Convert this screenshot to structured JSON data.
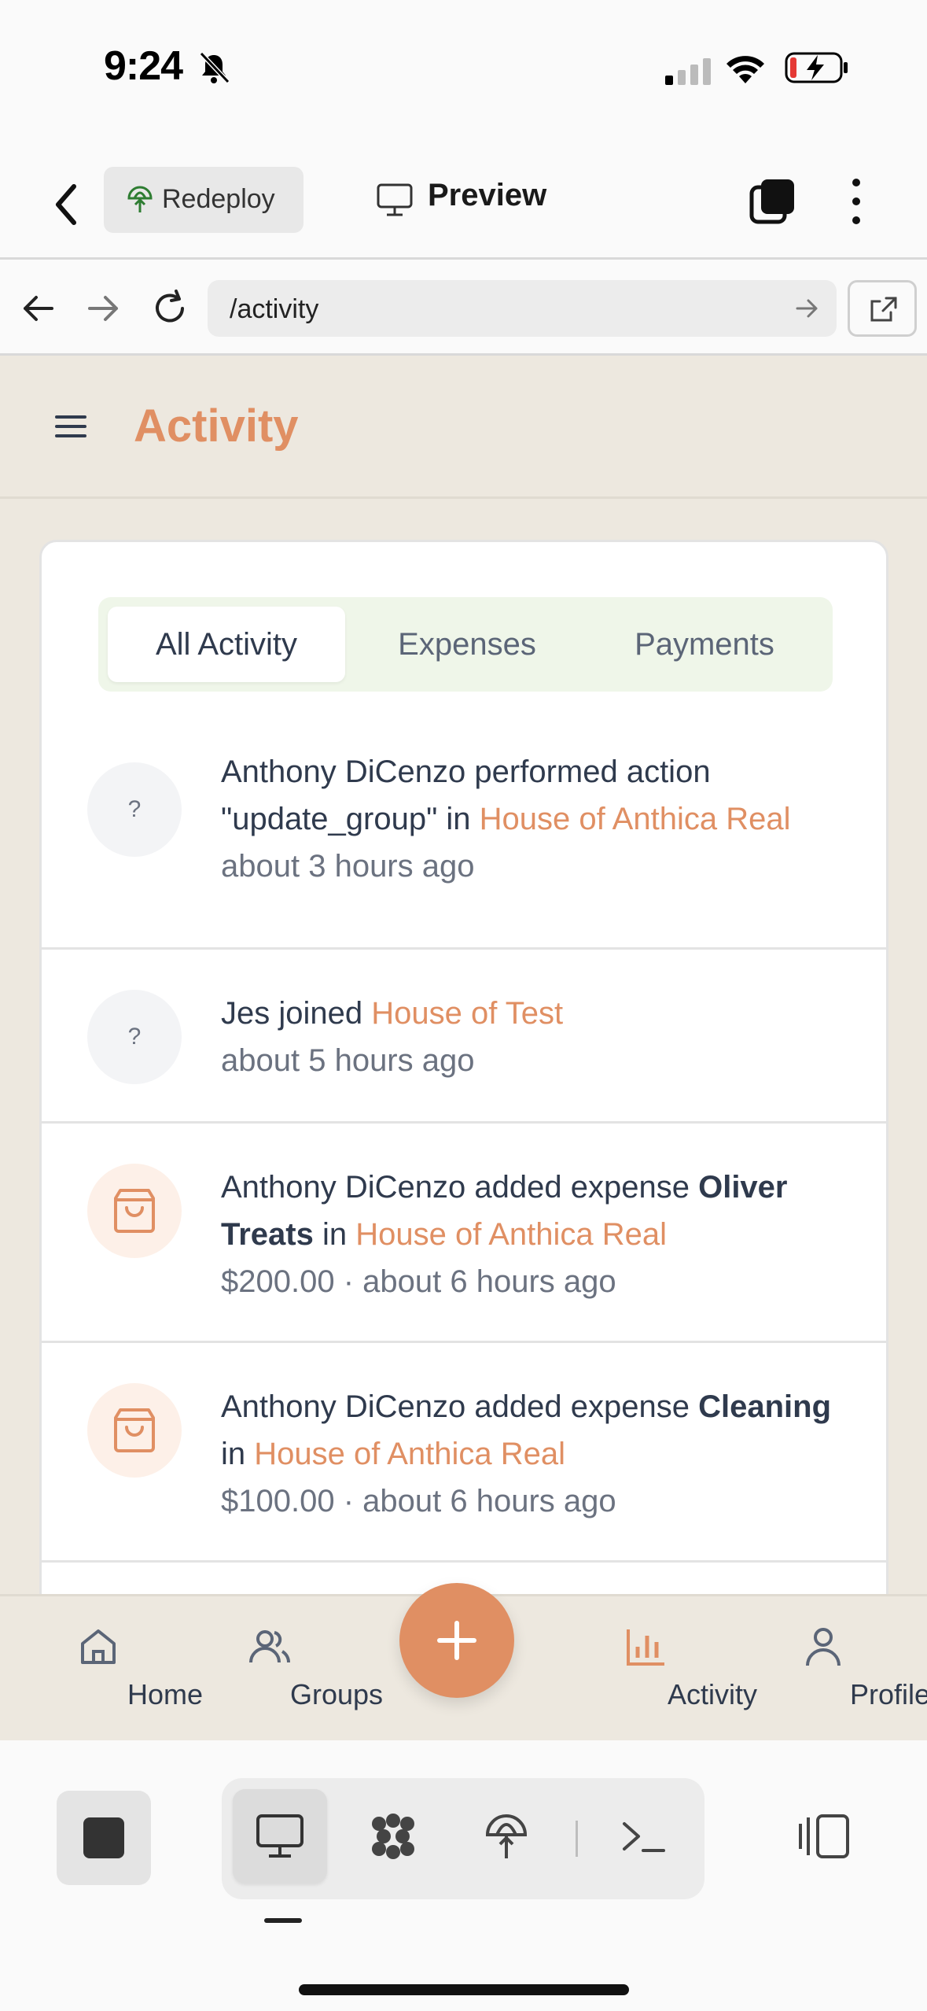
{
  "status_bar": {
    "time": "9:24"
  },
  "editor_bar": {
    "redeploy_label": "Redeploy",
    "preview_label": "Preview"
  },
  "url_bar": {
    "url": "/activity"
  },
  "app": {
    "title": "Activity",
    "tabs": [
      {
        "label": "All Activity",
        "active": true
      },
      {
        "label": "Expenses",
        "active": false
      },
      {
        "label": "Payments",
        "active": false
      }
    ],
    "feed": [
      {
        "avatar": "?",
        "icon": "question-icon",
        "pre": "Anthony DiCenzo performed action \"update_group\" in ",
        "group": "House of Anthica Real",
        "meta": "about 3 hours ago"
      },
      {
        "avatar": "?",
        "icon": "question-icon",
        "pre": "Jes joined ",
        "group": "House of Test",
        "meta": "about 5 hours ago"
      },
      {
        "icon": "shopping-bag-icon",
        "pre": "Anthony DiCenzo added expense ",
        "item": "Oliver Treats",
        "mid": " in ",
        "group": "House of Anthica Real",
        "meta": "$200.00 · about 6 hours ago"
      },
      {
        "icon": "shopping-bag-icon",
        "pre": "Anthony DiCenzo added expense ",
        "item": "Cleaning",
        "mid": " in ",
        "group": "House of Anthica Real",
        "meta": "$100.00 · about 6 hours ago"
      }
    ],
    "colors": {
      "accent": "#e08f63",
      "background": "#ede8df",
      "text": "#2f3a4d"
    }
  },
  "tabbar": {
    "home": "Home",
    "groups": "Groups",
    "activity": "Activity",
    "profile": "Profile",
    "active": "activity"
  }
}
